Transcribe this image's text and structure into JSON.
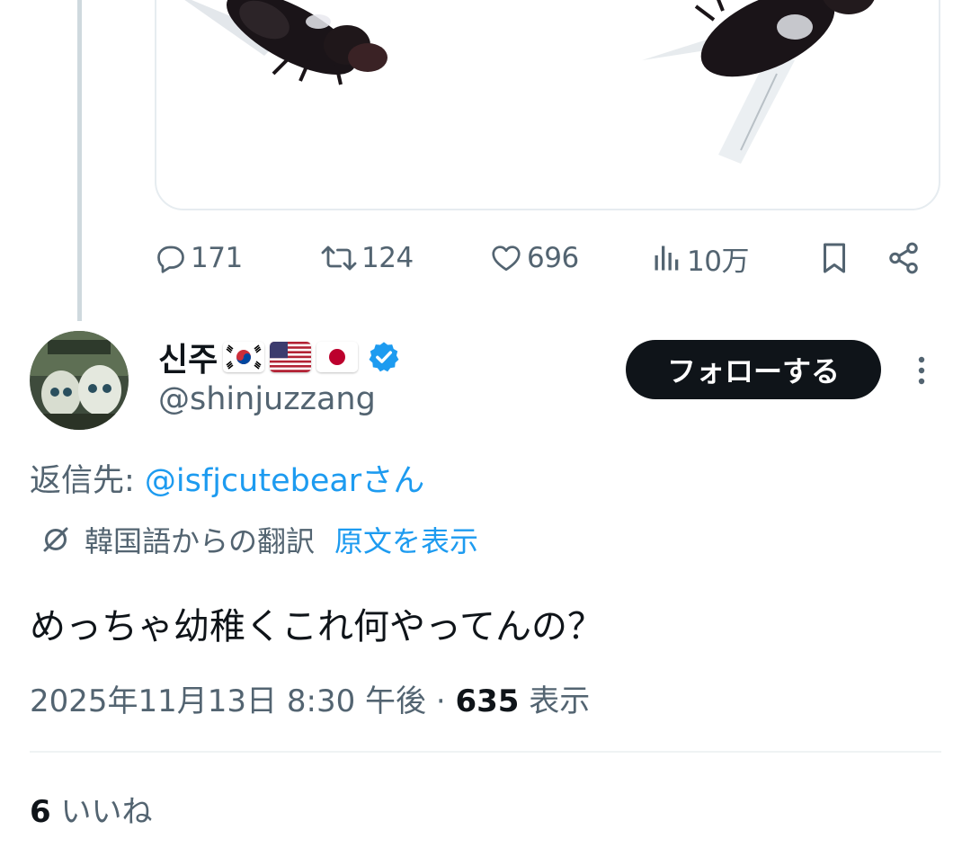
{
  "previous_tweet": {
    "media_alt": "",
    "actions": {
      "replies": "171",
      "retweets": "124",
      "likes": "696",
      "views": "10万"
    }
  },
  "tweet": {
    "display_name": "신주",
    "flags": [
      "south-korea-flag",
      "usa-flag",
      "japan-flag"
    ],
    "handle": "@shinjuzzang",
    "follow_label": "フォローする",
    "reply_to_label": "返信先: ",
    "reply_to_mention": "@isfjcutebear",
    "reply_to_suffix": "さん",
    "translation_label": "韓国語からの翻訳",
    "show_original_label": "原文を表示",
    "text": "めっちゃ幼稚くこれ何やってんの？",
    "timestamp": "2025年11月13日 8:30 午後",
    "separator": " · ",
    "views_count": "635",
    "views_label": " 表示",
    "likes_count": "6",
    "likes_label": " いいね"
  },
  "colors": {
    "text_primary": "#0f1419",
    "text_secondary": "#536471",
    "link": "#1d9bf0",
    "verified": "#1d9bf0",
    "follow_button_bg": "#0f1419",
    "thread_line": "#cfd9de"
  }
}
